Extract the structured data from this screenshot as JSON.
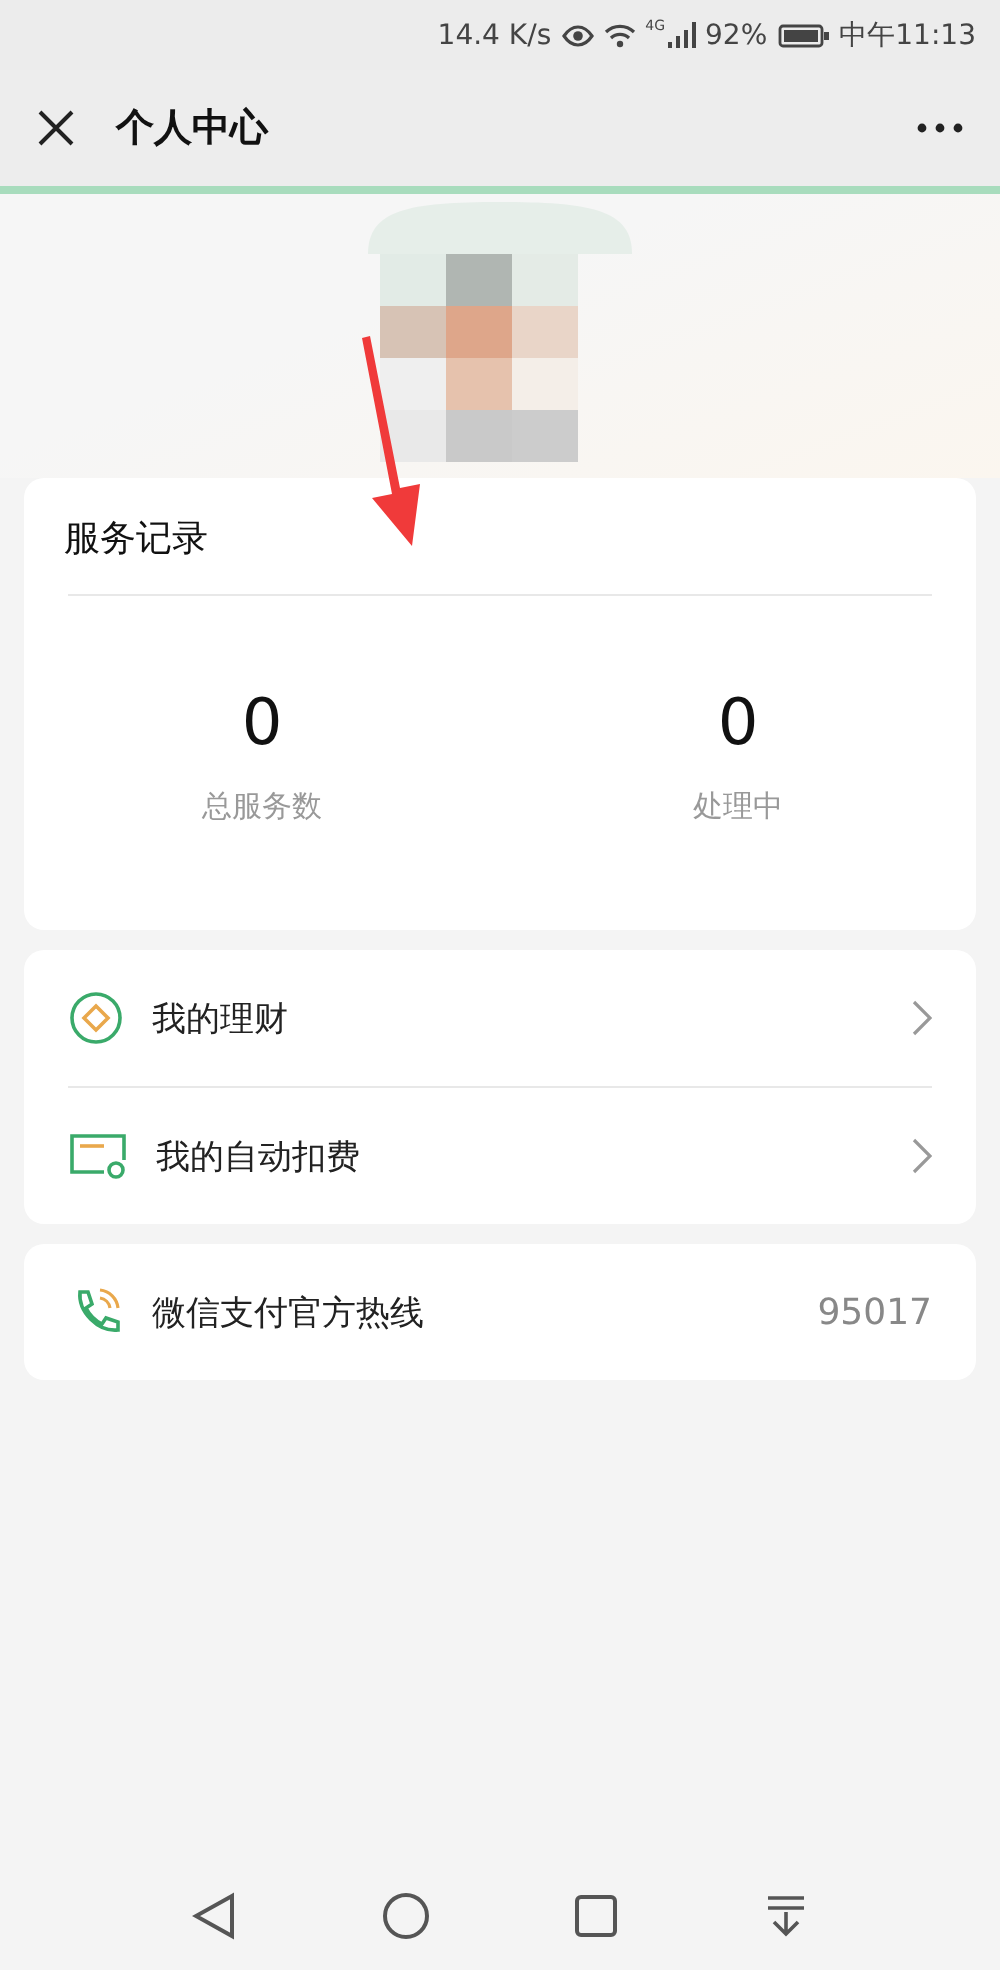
{
  "status_bar": {
    "speed": "14.4 K/s",
    "signal_tag": "4G",
    "battery": "92%",
    "time": "中午11:13"
  },
  "header": {
    "title": "个人中心"
  },
  "service_record": {
    "title": "服务记录",
    "stats": [
      {
        "value": "0",
        "label": "总服务数"
      },
      {
        "value": "0",
        "label": "处理中"
      }
    ]
  },
  "menu": [
    {
      "kind": "wealth",
      "label": "我的理财"
    },
    {
      "kind": "autopay",
      "label": "我的自动扣费"
    }
  ],
  "hotline": {
    "label": "微信支付官方热线",
    "number": "95017"
  }
}
